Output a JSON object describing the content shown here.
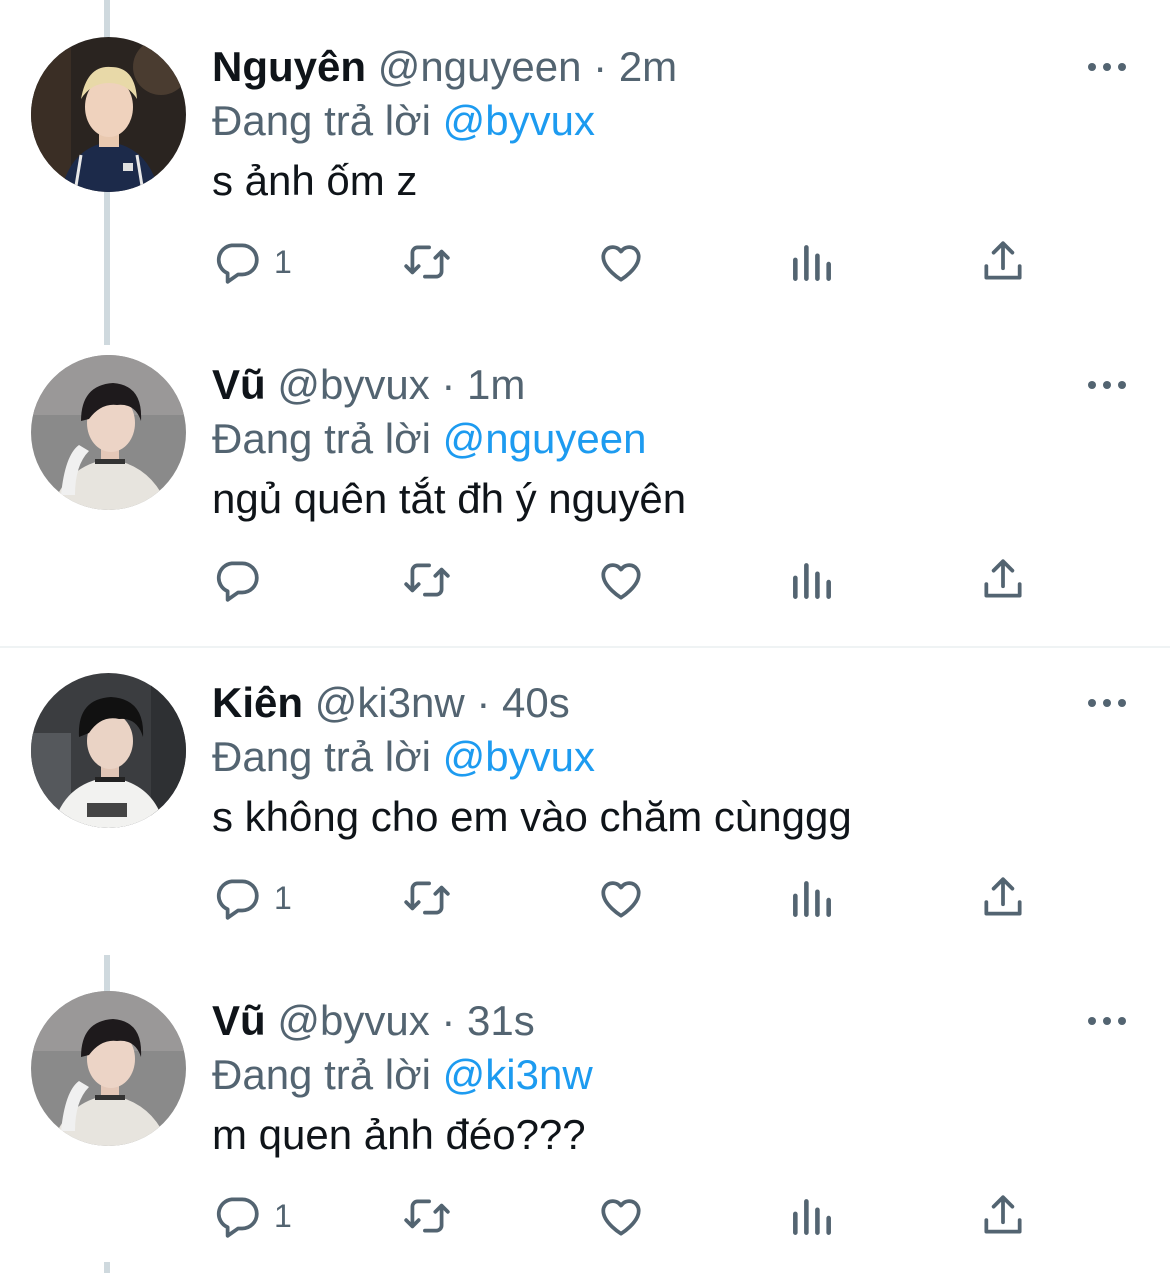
{
  "colors": {
    "text_primary": "#0f1419",
    "text_secondary": "#536471",
    "mention": "#1d9bf0",
    "thread_line": "#cfd9de",
    "divider": "#eff3f4"
  },
  "tweets": [
    {
      "name": "Nguyên",
      "handle": "@nguyeen",
      "separator": "·",
      "time": "2m",
      "reply_prefix": "Đang trả lời",
      "reply_to": "@byvux",
      "text": "s ảnh ốm z",
      "reply_count": "1",
      "icons": [
        "reply-icon",
        "retweet-icon",
        "like-icon",
        "views-icon",
        "share-icon",
        "more-icon"
      ]
    },
    {
      "name": "Vũ",
      "handle": "@byvux",
      "separator": "·",
      "time": "1m",
      "reply_prefix": "Đang trả lời",
      "reply_to": "@nguyeen",
      "text": "ngủ quên tắt đh ý nguyên",
      "reply_count": "",
      "icons": [
        "reply-icon",
        "retweet-icon",
        "like-icon",
        "views-icon",
        "share-icon",
        "more-icon"
      ]
    },
    {
      "name": "Kiên",
      "handle": "@ki3nw",
      "separator": "·",
      "time": "40s",
      "reply_prefix": "Đang trả lời",
      "reply_to": "@byvux",
      "text": "s không cho em vào chăm cùnggg",
      "reply_count": "1",
      "icons": [
        "reply-icon",
        "retweet-icon",
        "like-icon",
        "views-icon",
        "share-icon",
        "more-icon"
      ]
    },
    {
      "name": "Vũ",
      "handle": "@byvux",
      "separator": "·",
      "time": "31s",
      "reply_prefix": "Đang trả lời",
      "reply_to": "@ki3nw",
      "text": "m quen ảnh đéo???",
      "reply_count": "1",
      "icons": [
        "reply-icon",
        "retweet-icon",
        "like-icon",
        "views-icon",
        "share-icon",
        "more-icon"
      ]
    }
  ]
}
